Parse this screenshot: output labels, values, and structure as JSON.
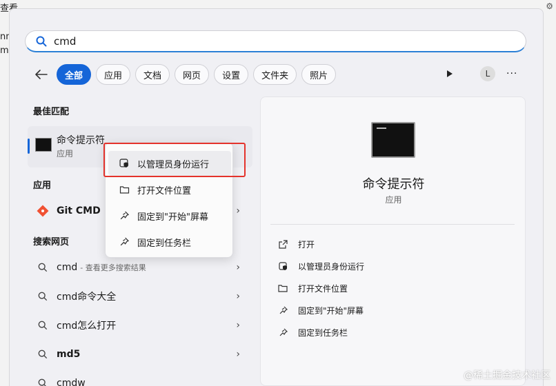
{
  "background": {
    "frag_top": "查看",
    "frag_side1": "nn",
    "frag_side2": "m"
  },
  "search": {
    "value": "cmd",
    "placeholder": ""
  },
  "filters": {
    "chips": [
      {
        "label": "全部",
        "active": true
      },
      {
        "label": "应用",
        "active": false
      },
      {
        "label": "文档",
        "active": false
      },
      {
        "label": "网页",
        "active": false
      },
      {
        "label": "设置",
        "active": false
      },
      {
        "label": "文件夹",
        "active": false
      },
      {
        "label": "照片",
        "active": false
      }
    ],
    "avatar": "L",
    "more": "···"
  },
  "sections": {
    "best_match": "最佳匹配",
    "apps": "应用",
    "web": "搜索网页"
  },
  "best_match": {
    "title": "命令提示符",
    "subtitle": "应用"
  },
  "apps": [
    {
      "label": "Git CMD"
    }
  ],
  "web_results": [
    {
      "label": "cmd",
      "sub": "- 查看更多搜索结果",
      "bold": false
    },
    {
      "label": "cmd命令大全",
      "sub": "",
      "bold": false
    },
    {
      "label": "cmd怎么打开",
      "sub": "",
      "bold": false
    },
    {
      "label": "md5",
      "sub": "",
      "bold": true
    },
    {
      "label": "cmdw",
      "sub": "",
      "bold": false
    }
  ],
  "context_menu": {
    "items": [
      {
        "label": "以管理员身份运行",
        "icon": "shield-icon"
      },
      {
        "label": "打开文件位置",
        "icon": "folder-icon"
      },
      {
        "label": "固定到\"开始\"屏幕",
        "icon": "pin-icon"
      },
      {
        "label": "固定到任务栏",
        "icon": "pin-icon"
      }
    ]
  },
  "detail": {
    "title": "命令提示符",
    "subtitle": "应用",
    "actions": [
      {
        "label": "打开",
        "icon": "open-icon"
      },
      {
        "label": "以管理员身份运行",
        "icon": "shield-icon"
      },
      {
        "label": "打开文件位置",
        "icon": "folder-icon"
      },
      {
        "label": "固定到\"开始\"屏幕",
        "icon": "pin-icon"
      },
      {
        "label": "固定到任务栏",
        "icon": "pin-icon"
      }
    ]
  },
  "watermark": "@稀土掘金技术社区",
  "colors": {
    "accent": "#1565d8",
    "highlight_box": "#e4322b"
  }
}
